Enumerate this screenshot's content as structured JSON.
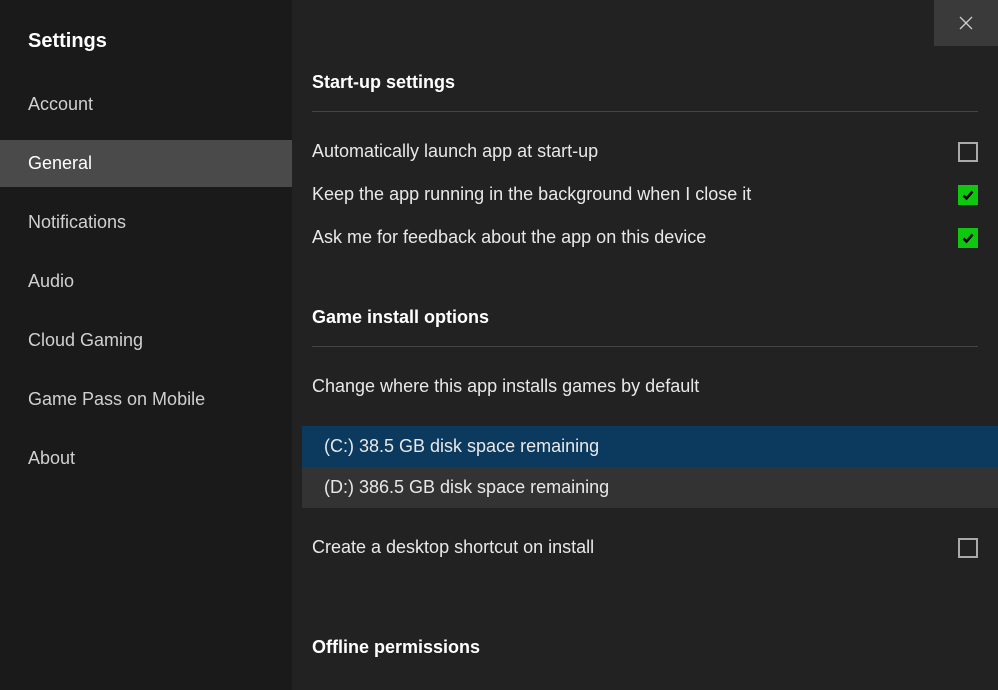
{
  "window": {
    "title": "Settings"
  },
  "sidebar": {
    "items": [
      {
        "label": "Account",
        "selected": false
      },
      {
        "label": "General",
        "selected": true
      },
      {
        "label": "Notifications",
        "selected": false
      },
      {
        "label": "Audio",
        "selected": false
      },
      {
        "label": "Cloud Gaming",
        "selected": false
      },
      {
        "label": "Game Pass on Mobile",
        "selected": false
      },
      {
        "label": "About",
        "selected": false
      }
    ]
  },
  "sections": {
    "startup": {
      "title": "Start-up settings",
      "auto_launch": {
        "label": "Automatically launch app at start-up",
        "checked": false
      },
      "keep_running": {
        "label": "Keep the app running in the background when I close it",
        "checked": true
      },
      "feedback": {
        "label": "Ask me for feedback about the app on this device",
        "checked": true
      }
    },
    "install": {
      "title": "Game install options",
      "change_location_label": "Change where this app installs games by default",
      "drives": [
        {
          "label": "(C:) 38.5 GB disk space remaining",
          "selected": true
        },
        {
          "label": "(D:) 386.5 GB disk space remaining",
          "selected": false
        }
      ],
      "shortcut": {
        "label": "Create a desktop shortcut on install",
        "checked": false
      }
    },
    "offline": {
      "title": "Offline permissions"
    }
  }
}
